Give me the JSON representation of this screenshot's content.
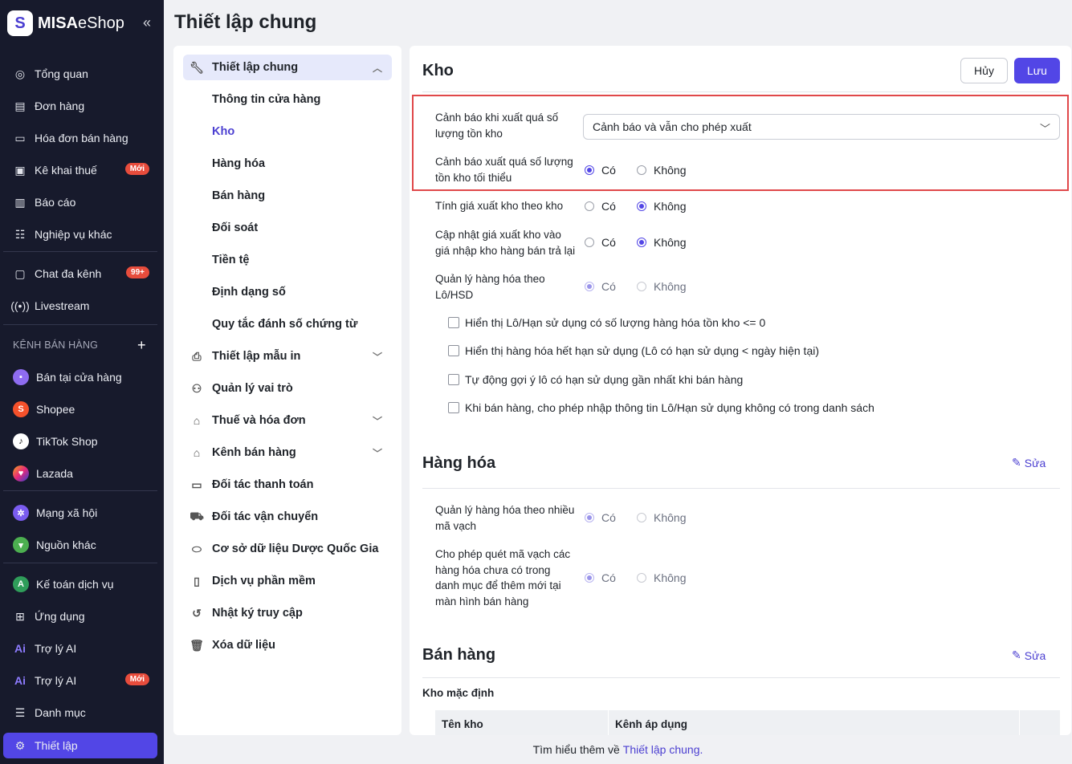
{
  "app": {
    "brand_bold": "MISA",
    "brand_light": "eShop",
    "logo_letter": "S"
  },
  "sidebar": {
    "items": [
      {
        "label": "Tổng quan",
        "icon": "dashboard-icon"
      },
      {
        "label": "Đơn hàng",
        "icon": "orders-icon"
      },
      {
        "label": "Hóa đơn bán hàng",
        "icon": "invoice-icon"
      },
      {
        "label": "Kê khai thuế",
        "icon": "tax-icon",
        "badge": "Mới"
      },
      {
        "label": "Báo cáo",
        "icon": "report-icon"
      },
      {
        "label": "Nghiệp vụ khác",
        "icon": "list-icon"
      },
      {
        "label": "Chat đa kênh",
        "icon": "chat-icon",
        "badge": "99+"
      },
      {
        "label": "Livestream",
        "icon": "livestream-icon"
      }
    ],
    "section_label": "KÊNH BÁN HÀNG",
    "channels": [
      {
        "label": "Bán tại cửa hàng",
        "color": "#8e6cf0"
      },
      {
        "label": "Shopee",
        "color": "#f5512b"
      },
      {
        "label": "TikTok Shop",
        "color": "#111111"
      },
      {
        "label": "Lazada",
        "color": "#2c3fd0"
      }
    ],
    "extras": [
      {
        "label": "Mạng xã hội",
        "color": "#7a5cf0"
      },
      {
        "label": "Nguồn khác",
        "color": "#4caf50"
      }
    ],
    "bottom": [
      {
        "label": "Kế toán dịch vụ",
        "icon": "accounting-icon"
      },
      {
        "label": "Ứng dụng",
        "icon": "apps-icon"
      },
      {
        "label": "Trợ lý AI",
        "icon": "ai-icon"
      },
      {
        "label": "Trợ lý AI",
        "icon": "ai-icon",
        "badge": "Mới"
      },
      {
        "label": "Danh mục",
        "icon": "menu-icon"
      },
      {
        "label": "Thiết lập",
        "icon": "settings-icon"
      }
    ]
  },
  "page": {
    "title": "Thiết lập chung"
  },
  "nav": {
    "general": "Thiết lập chung",
    "subs": [
      "Thông tin cửa hàng",
      "Kho",
      "Hàng hóa",
      "Bán hàng",
      "Đối soát",
      "Tiền tệ",
      "Định dạng số",
      "Quy tắc đánh số chứng từ"
    ],
    "items": [
      {
        "label": "Thiết lập mẫu in",
        "icon": "printer-icon"
      },
      {
        "label": "Quản lý vai trò",
        "icon": "user-role-icon"
      },
      {
        "label": "Thuế và hóa đơn",
        "icon": "bank-icon"
      },
      {
        "label": "Kênh bán hàng",
        "icon": "store-icon"
      },
      {
        "label": "Đối tác thanh toán",
        "icon": "card-icon"
      },
      {
        "label": "Đối tác vận chuyển",
        "icon": "truck-icon"
      },
      {
        "label": "Cơ sở dữ liệu Dược Quốc Gia",
        "icon": "pill-icon"
      },
      {
        "label": "Dịch vụ phần mềm",
        "icon": "document-icon"
      },
      {
        "label": "Nhật ký truy cập",
        "icon": "history-icon"
      },
      {
        "label": "Xóa dữ liệu",
        "icon": "trash-icon"
      }
    ]
  },
  "kho": {
    "title": "Kho",
    "cancel": "Hủy",
    "save": "Lưu",
    "warn_export_label": "Cảnh báo khi xuất quá số lượng tồn kho",
    "warn_export_value": "Cảnh báo và vẫn cho phép xuất",
    "warn_min_label": "Cảnh báo xuất quá số lượng tồn kho tối thiểu",
    "price_by_store_label": "Tính giá xuất kho theo kho",
    "update_price_label": "Cập nhật giá xuất kho vào giá nhập kho hàng bán trả lại",
    "lot_label": "Quản lý hàng hóa theo Lô/HSD",
    "yes": "Có",
    "no": "Không",
    "checkboxes": [
      "Hiển thị Lô/Hạn sử dụng có số lượng hàng hóa tồn kho <= 0",
      "Hiển thị hàng hóa hết hạn sử dụng (Lô có hạn sử dụng < ngày hiện tại)",
      "Tự động gợi ý lô có hạn sử dụng gần nhất khi bán hàng",
      "Khi bán hàng, cho phép nhập thông tin Lô/Hạn sử dụng không có trong danh sách"
    ]
  },
  "hanghoa": {
    "title": "Hàng hóa",
    "edit": "Sửa",
    "barcode_label": "Quản lý hàng hóa theo nhiều mã vạch",
    "scan_label": "Cho phép quét mã vạch các hàng hóa chưa có trong danh mục để thêm mới tại màn hình bán hàng"
  },
  "banhang": {
    "title": "Bán hàng",
    "edit": "Sửa",
    "default_store": "Kho mặc định",
    "columns": [
      "Tên kho",
      "Kênh áp dụng"
    ]
  },
  "footer": {
    "text": "Tìm hiểu thêm về",
    "link": "Thiết lập chung."
  }
}
